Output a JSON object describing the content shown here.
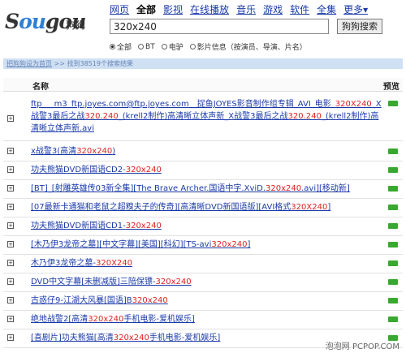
{
  "logo": {
    "word_start": "S",
    "word_mid": "ou",
    "word_end": "gou",
    "cn": "狗狗"
  },
  "nav": {
    "items": [
      "网页",
      "全部",
      "影视",
      "在线播放",
      "音乐",
      "游戏",
      "软件",
      "全集"
    ],
    "more": "更多▾"
  },
  "search": {
    "value": "320x240",
    "button": "狗狗搜索"
  },
  "radios": [
    "全部",
    "BT",
    "电驴",
    "影片信息（按演员、导演、片名）"
  ],
  "breadcrumb": {
    "link": "把狗狗设为首页",
    "sep": ">>",
    "result_text": "找到38519个搜索结果"
  },
  "table": {
    "col_name": "名称",
    "col_preview": "预览"
  },
  "rows": [
    {
      "parts": [
        [
          "ftp___m3_ftp.joyes.com@ftp.joyes.com__捉鱼JOYES影音制作组专辑_AVI_电影_",
          false
        ],
        [
          "320X240",
          true
        ],
        [
          "_X战警3最后之战",
          false
        ],
        [
          "320.240",
          true
        ],
        [
          "_(krell2制作)高清晰立体声新_X战警3最后之战",
          false
        ],
        [
          "320.240",
          true
        ],
        [
          "_(krell2制作)高清晰立体声新.avi",
          false
        ]
      ]
    },
    {
      "parts": [
        [
          "x战警3(高清",
          false
        ],
        [
          "320x240",
          true
        ],
        [
          ")",
          false
        ]
      ]
    },
    {
      "parts": [
        [
          "功夫熊猫DVD新国语CD2-",
          false
        ],
        [
          "320x240",
          true
        ]
      ]
    },
    {
      "parts": [
        [
          "[BT]_[射雕英雄传03新全集][The Brave Archer.国语中字.XviD.",
          false
        ],
        [
          "320x240",
          true
        ],
        [
          ".avi][移动新]",
          false
        ]
      ]
    },
    {
      "parts": [
        [
          "[07最新卡通猫和老鼠之超糗夫子的传奇][高清晰DVD新国语版][AVI格式",
          false
        ],
        [
          "320X240",
          true
        ],
        [
          "]",
          false
        ]
      ]
    },
    {
      "parts": [
        [
          "功夫熊猫DVD新国语CD1-",
          false
        ],
        [
          "320x240",
          true
        ]
      ]
    },
    {
      "parts": [
        [
          "[木乃伊3龙帝之墓][中文字幕][美国][科幻][TS-avi",
          false
        ],
        [
          "320x240",
          true
        ],
        [
          "]",
          false
        ]
      ]
    },
    {
      "parts": [
        [
          "木乃伊3龙帝之墓-",
          false
        ],
        [
          "320X240",
          true
        ]
      ]
    },
    {
      "parts": [
        [
          "DVD中文字幕[未删减版]三陪保镖-",
          false
        ],
        [
          "320x240",
          true
        ]
      ]
    },
    {
      "parts": [
        [
          "古惑仔9-江湖大风暴[国语]B",
          false
        ],
        [
          "320x240",
          true
        ]
      ]
    },
    {
      "parts": [
        [
          "绝地战警2[高清",
          false
        ],
        [
          "320x240",
          true
        ],
        [
          "手机电影-爱机娱乐]",
          false
        ]
      ]
    },
    {
      "parts": [
        [
          "[喜剧片]功夫熊猫[高清",
          false
        ],
        [
          "320x240",
          true
        ],
        [
          "手机电影-爱机娱乐]",
          false
        ]
      ]
    }
  ],
  "watermark": "泡泡网 PCPOP.COM",
  "colors": {
    "link": "#1a3aa8",
    "highlight": "#dd2222",
    "bar": "#cfe0f3",
    "preview": "#3aa830",
    "logo_accent": "#2d7fd6"
  }
}
